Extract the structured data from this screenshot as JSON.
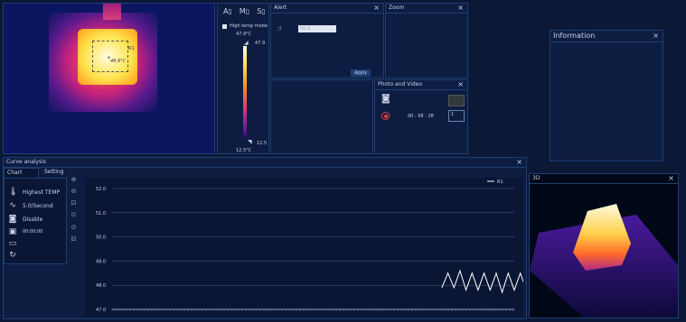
{
  "thermal_view": {
    "roi_label": "R1",
    "roi_temp": "48.9°C"
  },
  "colorbar": {
    "mode_label": "High temp mode",
    "top_temp": "47.9°C",
    "marker_high": "47.9",
    "marker_low": "12.5",
    "bottom_temp": "12.5°C"
  },
  "alert": {
    "title": "Alert",
    "value": "50.0",
    "apply_label": "Apply"
  },
  "zoom": {
    "title": "Zoom"
  },
  "photo_video": {
    "title": "Photo and Video",
    "timer": "00 : 08 : 28",
    "spinner_value": "1"
  },
  "information": {
    "title": "Information"
  },
  "curve": {
    "title": "Curve analysis",
    "tabs": [
      "Chart",
      "Setting"
    ],
    "sidebar": [
      {
        "icon": "thermometer-icon",
        "glyph": "🌡",
        "label": "Highest TEMP"
      },
      {
        "icon": "pulse-icon",
        "glyph": "∿",
        "label": "5.0/Second"
      },
      {
        "icon": "camera-icon",
        "glyph": "◙",
        "label": "Disable"
      },
      {
        "icon": "calendar-icon",
        "glyph": "▣",
        "label": "00:00:00"
      },
      {
        "icon": "folder-icon",
        "glyph": "▭",
        "label": ""
      },
      {
        "icon": "refresh-icon",
        "glyph": "↻",
        "label": ""
      }
    ]
  },
  "view3d": {
    "title": "3D"
  },
  "chart_data": {
    "type": "line",
    "yticks": [
      "52.0",
      "51.0",
      "50.0",
      "49.0",
      "48.0",
      "47.0"
    ],
    "ylim": [
      47,
      52
    ],
    "legend": "R1",
    "legend_position": "top-right",
    "grid": true,
    "series": [
      {
        "name": "R1",
        "x": [
          0.82,
          0.835,
          0.85,
          0.865,
          0.88,
          0.895,
          0.91,
          0.925,
          0.94,
          0.955,
          0.97,
          0.985,
          1.0,
          1.015,
          1.03,
          1.045,
          1.06,
          1.075,
          1.09,
          1.105,
          1.12
        ],
        "values": [
          47.9,
          48.5,
          47.9,
          48.6,
          47.8,
          48.5,
          47.8,
          48.5,
          47.8,
          48.5,
          47.7,
          48.5,
          47.8,
          48.5,
          47.8,
          48.5,
          47.8,
          48.5,
          47.8,
          48.5,
          47.9
        ]
      }
    ]
  }
}
